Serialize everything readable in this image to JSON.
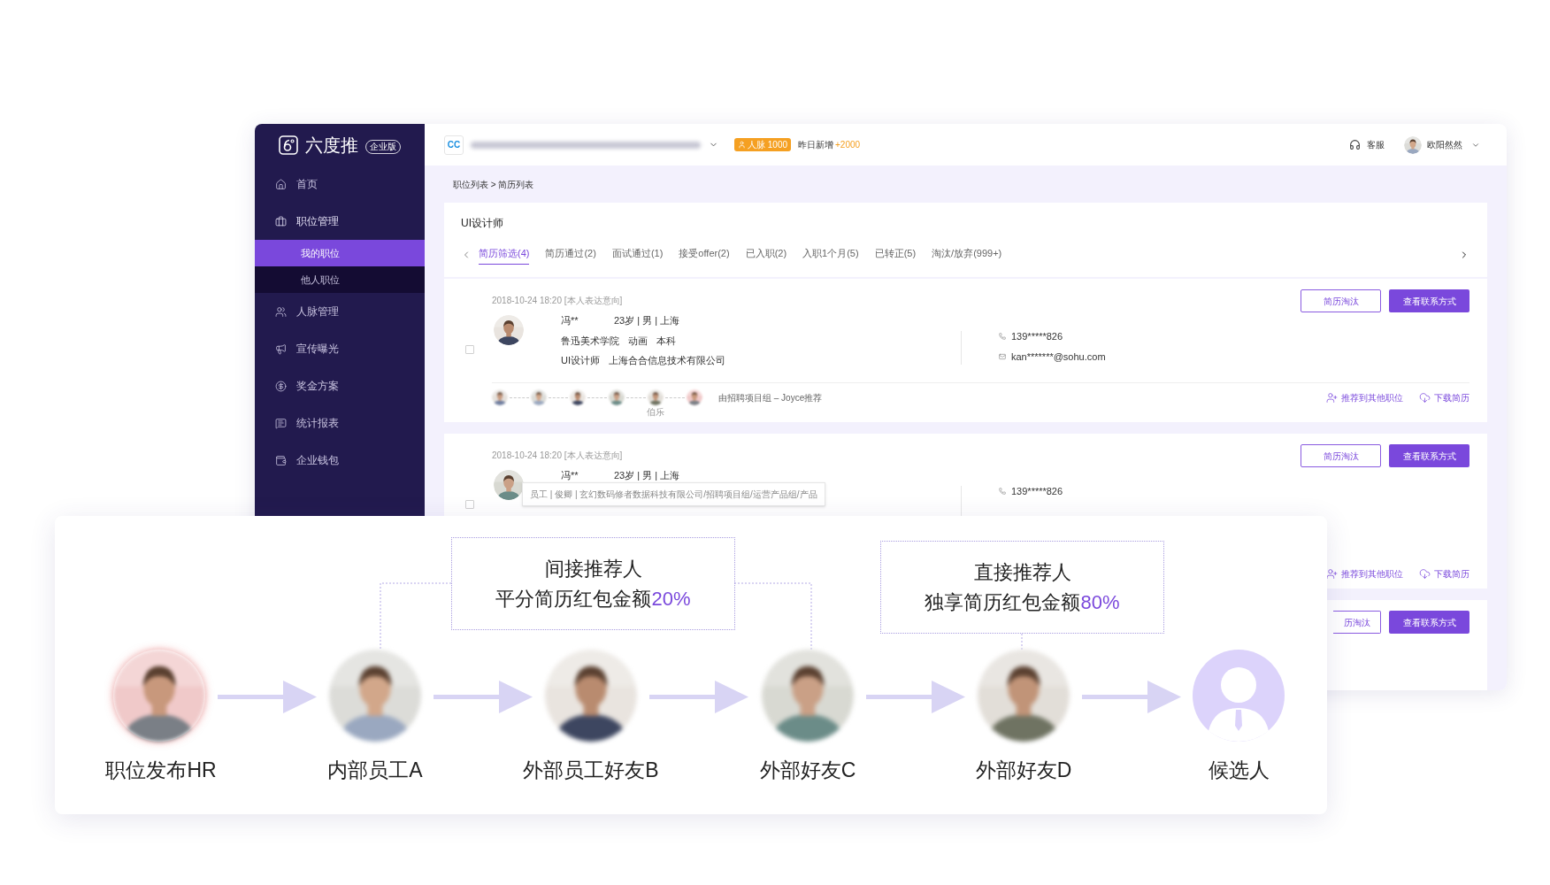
{
  "sidebar": {
    "brand": "六度推",
    "edition": "企业版",
    "items": [
      {
        "label": "首页"
      },
      {
        "label": "职位管理",
        "expanded": true,
        "children": [
          {
            "label": "我的职位",
            "selected": true
          },
          {
            "label": "他人职位",
            "selected": false
          }
        ]
      },
      {
        "label": "人脉管理"
      },
      {
        "label": "宣传曝光"
      },
      {
        "label": "奖金方案"
      },
      {
        "label": "统计报表"
      },
      {
        "label": "企业钱包"
      }
    ]
  },
  "header": {
    "logo": "CC",
    "quota_badge": "人脉 1000",
    "new_label": "昨日新增",
    "new_value": "+2000",
    "support": "客服",
    "user": "欧阳然然"
  },
  "breadcrumb": "职位列表 > 简历列表",
  "job": {
    "title": "UI设计师",
    "tabs": [
      {
        "label": "简历筛选(4)",
        "selected": true
      },
      {
        "label": "简历通过(2)",
        "selected": false
      },
      {
        "label": "面试通过(1)",
        "selected": false
      },
      {
        "label": "接受offer(2)",
        "selected": false
      },
      {
        "label": "已入职(2)",
        "selected": false
      },
      {
        "label": "入职1个月(5)",
        "selected": false
      },
      {
        "label": "已转正(5)",
        "selected": false
      },
      {
        "label": "淘汰/放弃(999+)",
        "selected": false
      }
    ]
  },
  "candidates": [
    {
      "date": "2018-10-24 18:20 [本人表达意向]",
      "checked": false,
      "name": "冯**",
      "info": "23岁 | 男 | 上海",
      "school": [
        "鲁迅美术学院",
        "动画",
        "本科"
      ],
      "work": [
        "UI设计师",
        "上海合合信息技术有限公司"
      ],
      "phone": "139*****826",
      "email": "kan*******@sohu.com",
      "reject": "简历淘汰",
      "contact": "查看联系方式",
      "chain_label": "伯乐",
      "referral": "由招聘项目组 – Joyce推荐",
      "recommend": "推荐到其他职位",
      "download": "下载简历"
    },
    {
      "date": "2018-10-24 18:20 [本人表达意向]",
      "checked": false,
      "name": "冯**",
      "info": "23岁 | 男 | 上海",
      "tooltip": "员工 | 俊卿 | 玄幻数码修者数据科技有限公司/招聘项目组/运营产品组/产品",
      "phone": "139*****826",
      "reject": "简历淘汰",
      "contact": "查看联系方式",
      "recommend": "推荐到其他职位",
      "download": "下载简历"
    },
    {
      "reject": "历淘汰",
      "contact": "查看联系方式"
    }
  ],
  "flow": {
    "callouts": [
      {
        "title": "间接推荐人",
        "text": "平分简历红包金额",
        "share": "20%"
      },
      {
        "title": "直接推荐人",
        "text": "独享简历红包金额",
        "share": "80%"
      }
    ],
    "nodes": [
      {
        "label": "职位发布HR",
        "kind": "publisher"
      },
      {
        "label": "内部员工A",
        "kind": "referrer"
      },
      {
        "label": "外部员工好友B",
        "kind": "referrer"
      },
      {
        "label": "外部好友C",
        "kind": "referrer"
      },
      {
        "label": "外部好友D",
        "kind": "referrer"
      },
      {
        "label": "候选人",
        "kind": "candidate"
      }
    ]
  }
}
